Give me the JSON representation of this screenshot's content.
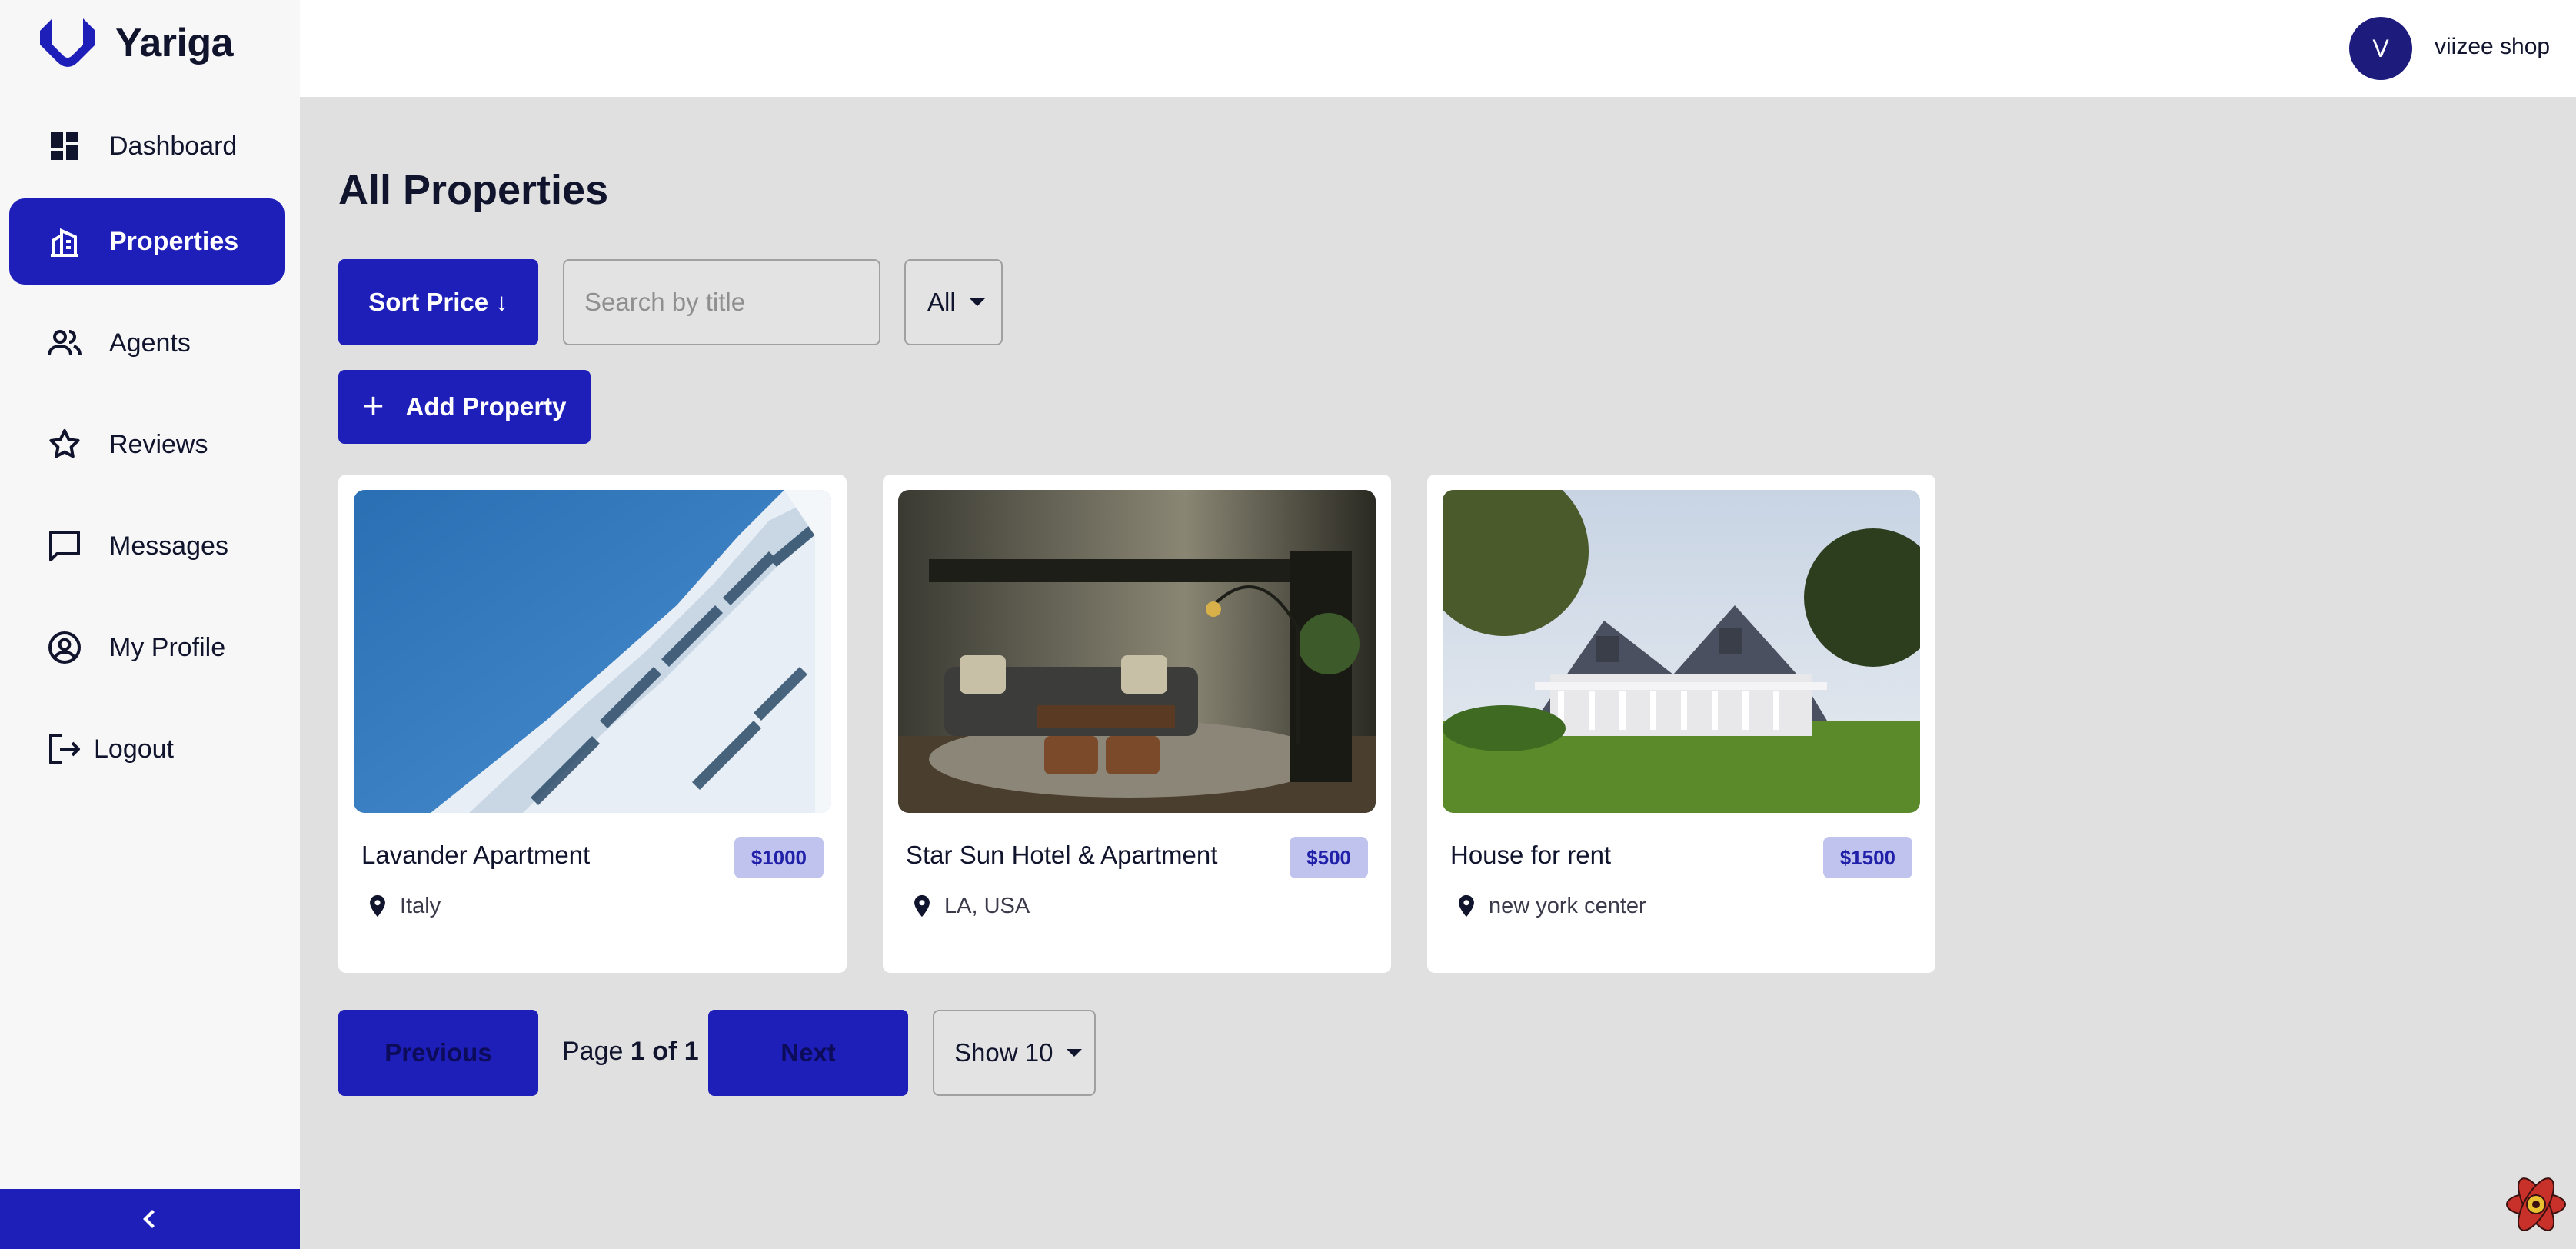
{
  "brand": {
    "name": "Yariga",
    "accent": "#1e1eb9"
  },
  "sidebar": {
    "items": [
      {
        "label": "Dashboard",
        "icon": "dashboard-icon"
      },
      {
        "label": "Properties",
        "icon": "properties-icon",
        "active": true
      },
      {
        "label": "Agents",
        "icon": "agents-icon"
      },
      {
        "label": "Reviews",
        "icon": "star-icon"
      },
      {
        "label": "Messages",
        "icon": "chat-icon"
      },
      {
        "label": "My Profile",
        "icon": "profile-icon"
      },
      {
        "label": "Logout",
        "icon": "logout-icon"
      }
    ],
    "collapse_icon": "chevron-left-icon"
  },
  "header": {
    "avatar_initial": "V",
    "user_name": "viizee shop"
  },
  "main": {
    "title": "All Properties",
    "sort_label": "Sort Price ↓",
    "search_placeholder": "Search by title",
    "search_value": "",
    "filter_value": "All",
    "add_label": "Add Property",
    "properties": [
      {
        "title": "Lavander Apartment",
        "price": "$1000",
        "location": "Italy",
        "image": "modern-building-photo"
      },
      {
        "title": "Star Sun Hotel & Apartment",
        "price": "$500",
        "location": "LA, USA",
        "image": "living-room-photo"
      },
      {
        "title": "House for rent",
        "price": "$1500",
        "location": "new york center",
        "image": "house-photo"
      }
    ],
    "pagination": {
      "previous_label": "Previous",
      "next_label": "Next",
      "page_prefix": "Page",
      "page_value": "1 of 1",
      "page_size_label": "Show 10"
    }
  }
}
